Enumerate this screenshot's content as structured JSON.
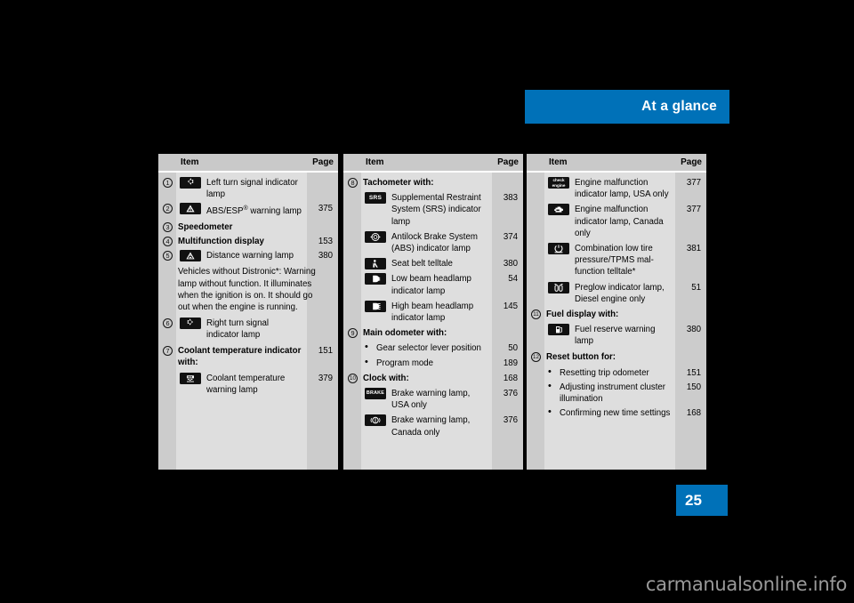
{
  "header": {
    "title": "At a glance",
    "accent_color": "#0071b8"
  },
  "page_number": "25",
  "watermark": "carmanualsonline.info",
  "columns": {
    "header_item": "Item",
    "header_page": "Page"
  },
  "tables": [
    {
      "id": "table-left",
      "rows": [
        {
          "num": "1",
          "icon": "turn-signal-left-icon",
          "text": "Left turn signal indicator lamp",
          "page": ""
        },
        {
          "num": "2",
          "icon": "abs-esp-warning-icon",
          "text": "ABS/ESP® warning lamp",
          "page": "375",
          "has_sup": true,
          "text_pre": "ABS/ESP",
          "sup": "®",
          "text_post": " warning lamp"
        },
        {
          "num": "3",
          "icon": "",
          "text": "Speedometer",
          "bold": true,
          "page": ""
        },
        {
          "num": "4",
          "icon": "",
          "text": "Multifunction display",
          "bold": true,
          "page": "153"
        },
        {
          "num": "5",
          "icon": "distance-warning-icon",
          "text": "Distance warning lamp",
          "page": "380"
        },
        {
          "num": "",
          "icon": "",
          "text": "Vehicles without Distronic*: Warning lamp without function. It illuminates when the ignition is on. It should go out when the engine is running.",
          "page": "",
          "paragraph": true
        },
        {
          "num": "6",
          "icon": "turn-signal-right-icon",
          "text": "Right turn signal indicator lamp",
          "page": ""
        },
        {
          "num": "7",
          "icon": "",
          "text": "Coolant temperature indicator with:",
          "bold": true,
          "page": "151"
        },
        {
          "num": "",
          "icon": "coolant-temperature-icon",
          "text": "Coolant temperature warning lamp",
          "page": "379"
        }
      ]
    },
    {
      "id": "table-middle",
      "rows": [
        {
          "num": "8",
          "icon": "",
          "text": "Tachometer with:",
          "bold": true,
          "page": ""
        },
        {
          "num": "",
          "icon": "srs-icon",
          "text": "Supplemental Restraint System (SRS) indicator lamp",
          "page": "383"
        },
        {
          "num": "",
          "icon": "abs-icon",
          "text": "Antilock Brake System (ABS) indicator lamp",
          "page": "374"
        },
        {
          "num": "",
          "icon": "seat-belt-icon",
          "text": "Seat belt telltale",
          "page": "380"
        },
        {
          "num": "",
          "icon": "low-beam-icon",
          "text": "Low beam headlamp indicator lamp",
          "page": "54"
        },
        {
          "num": "",
          "icon": "high-beam-icon",
          "text": "High beam headlamp indicator lamp",
          "page": "145"
        },
        {
          "num": "9",
          "icon": "",
          "text": "Main odometer with:",
          "bold": true,
          "page": ""
        },
        {
          "num": "",
          "bullet": true,
          "text": "Gear selector lever position",
          "page": "50"
        },
        {
          "num": "",
          "bullet": true,
          "text": "Program mode",
          "page": "189"
        },
        {
          "num": "10",
          "icon": "",
          "text": "Clock with:",
          "bold": true,
          "page": "168"
        },
        {
          "num": "",
          "icon": "brake-warning-usa-icon",
          "text": "Brake warning lamp, USA only",
          "page": "376"
        },
        {
          "num": "",
          "icon": "brake-warning-canada-icon",
          "text": "Brake warning lamp, Canada only",
          "page": "376"
        }
      ]
    },
    {
      "id": "table-right",
      "rows": [
        {
          "num": "",
          "icon": "check-engine-icon",
          "text": "Engine malfunction indicator lamp, USA only",
          "page": "377"
        },
        {
          "num": "",
          "icon": "engine-malfunction-canada-icon",
          "text": "Engine malfunction indicator lamp, Canada only",
          "page": "377"
        },
        {
          "num": "",
          "icon": "tire-pressure-icon",
          "text": "Combination low tire pressure/TPMS mal-function telltale*",
          "page": "381"
        },
        {
          "num": "",
          "icon": "preglow-icon",
          "text": "Preglow indicator lamp, Diesel engine only",
          "page": "51"
        },
        {
          "num": "11",
          "icon": "",
          "text": "Fuel display with:",
          "bold": true,
          "page": ""
        },
        {
          "num": "",
          "icon": "fuel-reserve-icon",
          "text": "Fuel reserve warning lamp",
          "page": "380"
        },
        {
          "num": "12",
          "icon": "",
          "text": "Reset button for:",
          "bold": true,
          "page": ""
        },
        {
          "num": "",
          "bullet": true,
          "text": "Resetting trip odometer",
          "page": "151"
        },
        {
          "num": "",
          "bullet": true,
          "text": "Adjusting instrument cluster illumination",
          "page": "150"
        },
        {
          "num": "",
          "bullet": true,
          "text": "Confirming new time settings",
          "page": "168"
        }
      ]
    }
  ]
}
